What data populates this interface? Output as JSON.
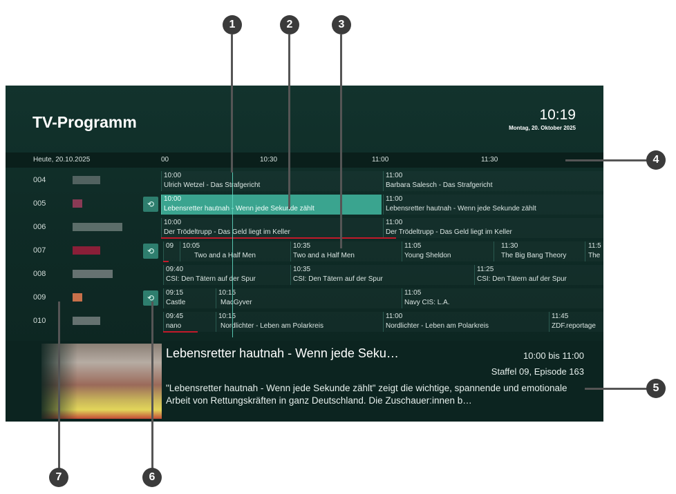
{
  "header": {
    "title": "TV-Programm",
    "time": "10:19",
    "date": "Montag, 20. Oktober 2025"
  },
  "timeline": {
    "day": "Heute, 20.10.2025",
    "ticks": [
      "00",
      "10:30",
      "11:00",
      "11:30"
    ]
  },
  "channels": [
    {
      "number": "004",
      "logo_color": "#7d8784",
      "programs": [
        {
          "time": "10:00",
          "title": "Ulrich Wetzel - Das Strafgericht"
        },
        {
          "time": "11:00",
          "title": "Barbara Salesch - Das Strafgericht"
        }
      ]
    },
    {
      "number": "005",
      "logo_color": "#8a3a55",
      "replay": true,
      "programs": [
        {
          "time": "10:00",
          "title": "Lebensretter hautnah - Wenn jede Sekunde zählt",
          "selected": true
        },
        {
          "time": "11:00",
          "title": "Lebensretter hautnah - Wenn jede Sekunde zählt"
        }
      ]
    },
    {
      "number": "006",
      "logo_color": "#7a8c88",
      "programs": [
        {
          "time": "10:00",
          "title": "Der Trödeltrupp - Das Geld liegt im Keller"
        },
        {
          "time": "11:00",
          "title": "Der Trödeltrupp - Das Geld liegt im Keller"
        }
      ]
    },
    {
      "number": "007",
      "logo_color": "#8a1f38",
      "replay": true,
      "programs": [
        {
          "time": "09",
          "title": ""
        },
        {
          "time": "10:05",
          "title": "Two and a Half Men"
        },
        {
          "time": "10:35",
          "title": "Two and a Half Men"
        },
        {
          "time": "11:05",
          "title": "Young Sheldon"
        },
        {
          "time": "11:30",
          "title": "The Big Bang Theory"
        },
        {
          "time": "11:5",
          "title": "The"
        }
      ]
    },
    {
      "number": "008",
      "logo_color": "#8a8f8e",
      "programs": [
        {
          "time": "09:40",
          "title": "CSI: Den Tätern auf der Spur"
        },
        {
          "time": "10:35",
          "title": "CSI: Den Tätern auf der Spur"
        },
        {
          "time": "11:25",
          "title": "CSI: Den Tätern auf der Spur"
        }
      ]
    },
    {
      "number": "009",
      "logo_color": "#c8704a",
      "replay": true,
      "programs": [
        {
          "time": "09:15",
          "title": "Castle"
        },
        {
          "time": "10:15",
          "title": "MacGyver"
        },
        {
          "time": "11:05",
          "title": "Navy CIS: L.A."
        }
      ]
    },
    {
      "number": "010",
      "logo_color": "#8a9490",
      "programs": [
        {
          "time": "09:45",
          "title": "nano"
        },
        {
          "time": "10:15",
          "title": "Nordlichter - Leben am Polarkreis"
        },
        {
          "time": "11:00",
          "title": "Nordlichter - Leben am Polarkreis"
        },
        {
          "time": "11:45",
          "title": "ZDF.reportage"
        }
      ]
    }
  ],
  "detail": {
    "title": "Lebensretter hautnah - Wenn jede Seku…",
    "time_range": "10:00 bis 11:00",
    "episode": "Staffel 09, Episode 163",
    "description": "\"Lebensretter hautnah - Wenn jede Sekunde zählt\" zeigt die wichtige, spannende und emotionale Arbeit von Rettungskräften in ganz Deutschland. Die Zuschauer:innen b…"
  },
  "callouts": [
    "1",
    "2",
    "3",
    "4",
    "5",
    "6",
    "7"
  ],
  "icons": {
    "replay": "replay-icon"
  },
  "colors": {
    "accent": "#3aa48f",
    "now_line": "#5fd6bf",
    "progress": "#c31a2a",
    "background": "#0f2b26"
  }
}
